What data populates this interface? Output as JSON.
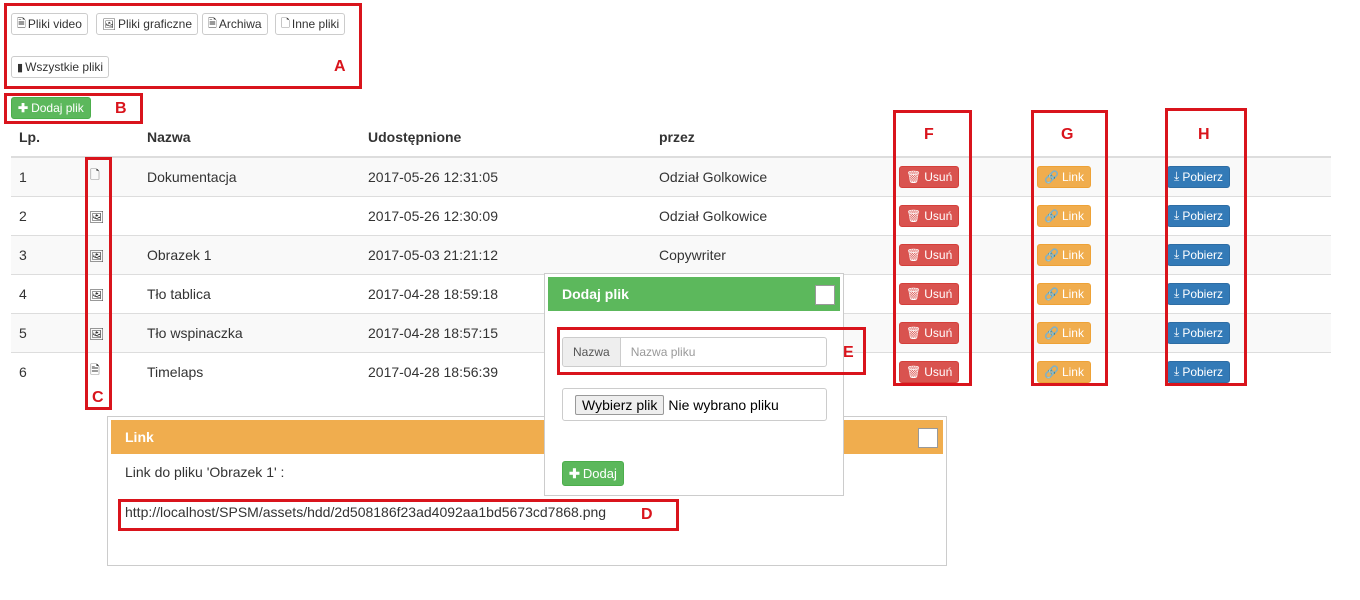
{
  "filters": {
    "video": "Pliki video",
    "graphic": "Pliki graficzne",
    "archive": "Archiwa",
    "other": "Inne pliki",
    "all": "Wszystkie pliki"
  },
  "add_button": "Dodaj plik",
  "table": {
    "headers": {
      "lp": "Lp.",
      "name": "Nazwa",
      "shared": "Udostępnione",
      "by": "przez"
    },
    "rows": [
      {
        "lp": "1",
        "icon": "document-icon",
        "name": "Dokumentacja",
        "shared": "2017-05-26 12:31:05",
        "by": "Odział Golkowice"
      },
      {
        "lp": "2",
        "icon": "image-icon",
        "name": "",
        "shared": "2017-05-26 12:30:09",
        "by": "Odział Golkowice"
      },
      {
        "lp": "3",
        "icon": "image-icon",
        "name": "Obrazek 1",
        "shared": "2017-05-03 21:21:12",
        "by": "Copywriter"
      },
      {
        "lp": "4",
        "icon": "image-icon",
        "name": "Tło tablica",
        "shared": "2017-04-28 18:59:18",
        "by": ""
      },
      {
        "lp": "5",
        "icon": "image-icon",
        "name": "Tło wspinaczka",
        "shared": "2017-04-28 18:57:15",
        "by": ""
      },
      {
        "lp": "6",
        "icon": "video-icon",
        "name": "Timelaps",
        "shared": "2017-04-28 18:56:39",
        "by": ""
      }
    ],
    "actions": {
      "delete": "Usuń",
      "link": "Link",
      "download": "Pobierz"
    }
  },
  "add_panel": {
    "title": "Dodaj plik",
    "name_addon": "Nazwa",
    "name_placeholder": "Nazwa pliku",
    "choose_file": "Wybierz plik",
    "no_file": "Nie wybrano pliku",
    "submit": "Dodaj"
  },
  "link_panel": {
    "title": "Link",
    "text": "Link do pliku 'Obrazek 1' :",
    "url": "http://localhost/SPSM/assets/hdd/2d508186f23ad4092aa1bd5673cd7868.png"
  },
  "labels": {
    "A": "A",
    "B": "B",
    "C": "C",
    "D": "D",
    "E": "E",
    "F": "F",
    "G": "G",
    "H": "H"
  },
  "colors": {
    "green": "#5cb85c",
    "orange": "#f0ad4e",
    "red": "#d9534f",
    "blue": "#337ab7",
    "annotation": "#d9141c"
  }
}
